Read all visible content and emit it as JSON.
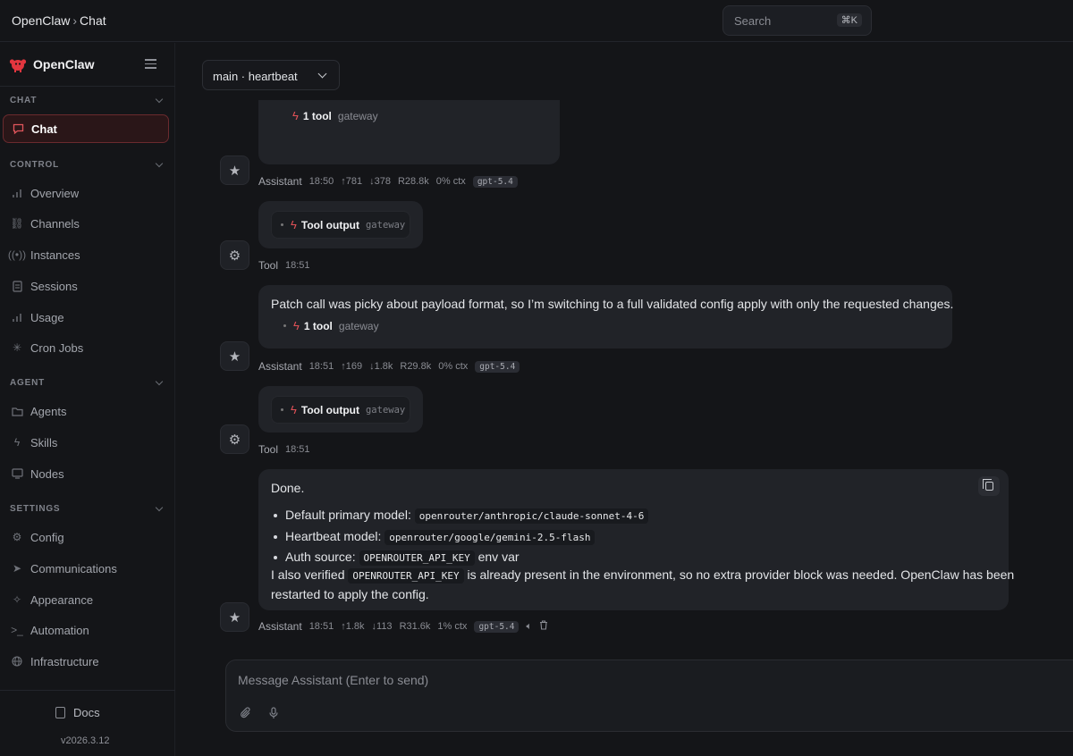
{
  "topbar": {
    "breadcrumb": [
      "OpenClaw",
      "Chat"
    ],
    "search_placeholder": "Search",
    "search_shortcut": "⌘K"
  },
  "sidebar": {
    "brand": "OpenClaw",
    "sections": [
      {
        "title": "CHAT",
        "items": [
          {
            "label": "Chat",
            "icon": "message-icon",
            "active": true
          }
        ]
      },
      {
        "title": "CONTROL",
        "items": [
          {
            "label": "Overview",
            "icon": "bar-chart-icon"
          },
          {
            "label": "Channels",
            "icon": "link-icon"
          },
          {
            "label": "Instances",
            "icon": "radio-icon"
          },
          {
            "label": "Sessions",
            "icon": "document-icon"
          },
          {
            "label": "Usage",
            "icon": "bar-chart-icon"
          },
          {
            "label": "Cron Jobs",
            "icon": "loader-icon"
          }
        ]
      },
      {
        "title": "AGENT",
        "items": [
          {
            "label": "Agents",
            "icon": "folder-icon"
          },
          {
            "label": "Skills",
            "icon": "bolt-icon"
          },
          {
            "label": "Nodes",
            "icon": "monitor-icon"
          }
        ]
      },
      {
        "title": "SETTINGS",
        "items": [
          {
            "label": "Config",
            "icon": "gear-icon"
          },
          {
            "label": "Communications",
            "icon": "send-icon"
          },
          {
            "label": "Appearance",
            "icon": "sparkle-icon"
          },
          {
            "label": "Automation",
            "icon": "terminal-icon"
          },
          {
            "label": "Infrastructure",
            "icon": "globe-icon"
          }
        ]
      }
    ],
    "docs_label": "Docs",
    "version": "v2026.3.12"
  },
  "session": {
    "selected": "main · heartbeat"
  },
  "messages": [
    {
      "role": "Assistant",
      "time": "18:50",
      "up": "↑781",
      "down": "↓378",
      "r": "R28.8k",
      "ctx": "0% ctx",
      "model": "gpt-5.4",
      "tool_label": "1 tool",
      "tool_src": "gateway"
    },
    {
      "role": "Tool",
      "time": "18:51",
      "tool_label": "Tool output",
      "tool_src": "gateway"
    },
    {
      "role": "Assistant",
      "time": "18:51",
      "up": "↑169",
      "down": "↓1.8k",
      "r": "R29.8k",
      "ctx": "0% ctx",
      "model": "gpt-5.4",
      "text": "Patch call was picky about payload format, so I’m switching to a full validated config apply with only the requested changes.",
      "tool_label": "1 tool",
      "tool_src": "gateway"
    },
    {
      "role": "Tool",
      "time": "18:51",
      "tool_label": "Tool output",
      "tool_src": "gateway"
    },
    {
      "role": "Assistant",
      "time": "18:51",
      "up": "↑1.8k",
      "down": "↓113",
      "r": "R31.6k",
      "ctx": "1% ctx",
      "model": "gpt-5.4",
      "done": "Done.",
      "bullets": [
        {
          "label": "Default primary model:",
          "code": "openrouter/anthropic/claude-sonnet-4-6",
          "after": ""
        },
        {
          "label": "Heartbeat model:",
          "code": "openrouter/google/gemini-2.5-flash",
          "after": ""
        },
        {
          "label": "Auth source:",
          "code": "OPENROUTER_API_KEY",
          "after": "env var"
        }
      ],
      "para_before": "I also verified",
      "para_code": "OPENROUTER_API_KEY",
      "para_after": "is already present in the environment, so no extra provider block was needed. OpenClaw has been",
      "para_line2": "restarted to apply the config."
    }
  ],
  "composer": {
    "placeholder": "Message Assistant (Enter to send)"
  }
}
